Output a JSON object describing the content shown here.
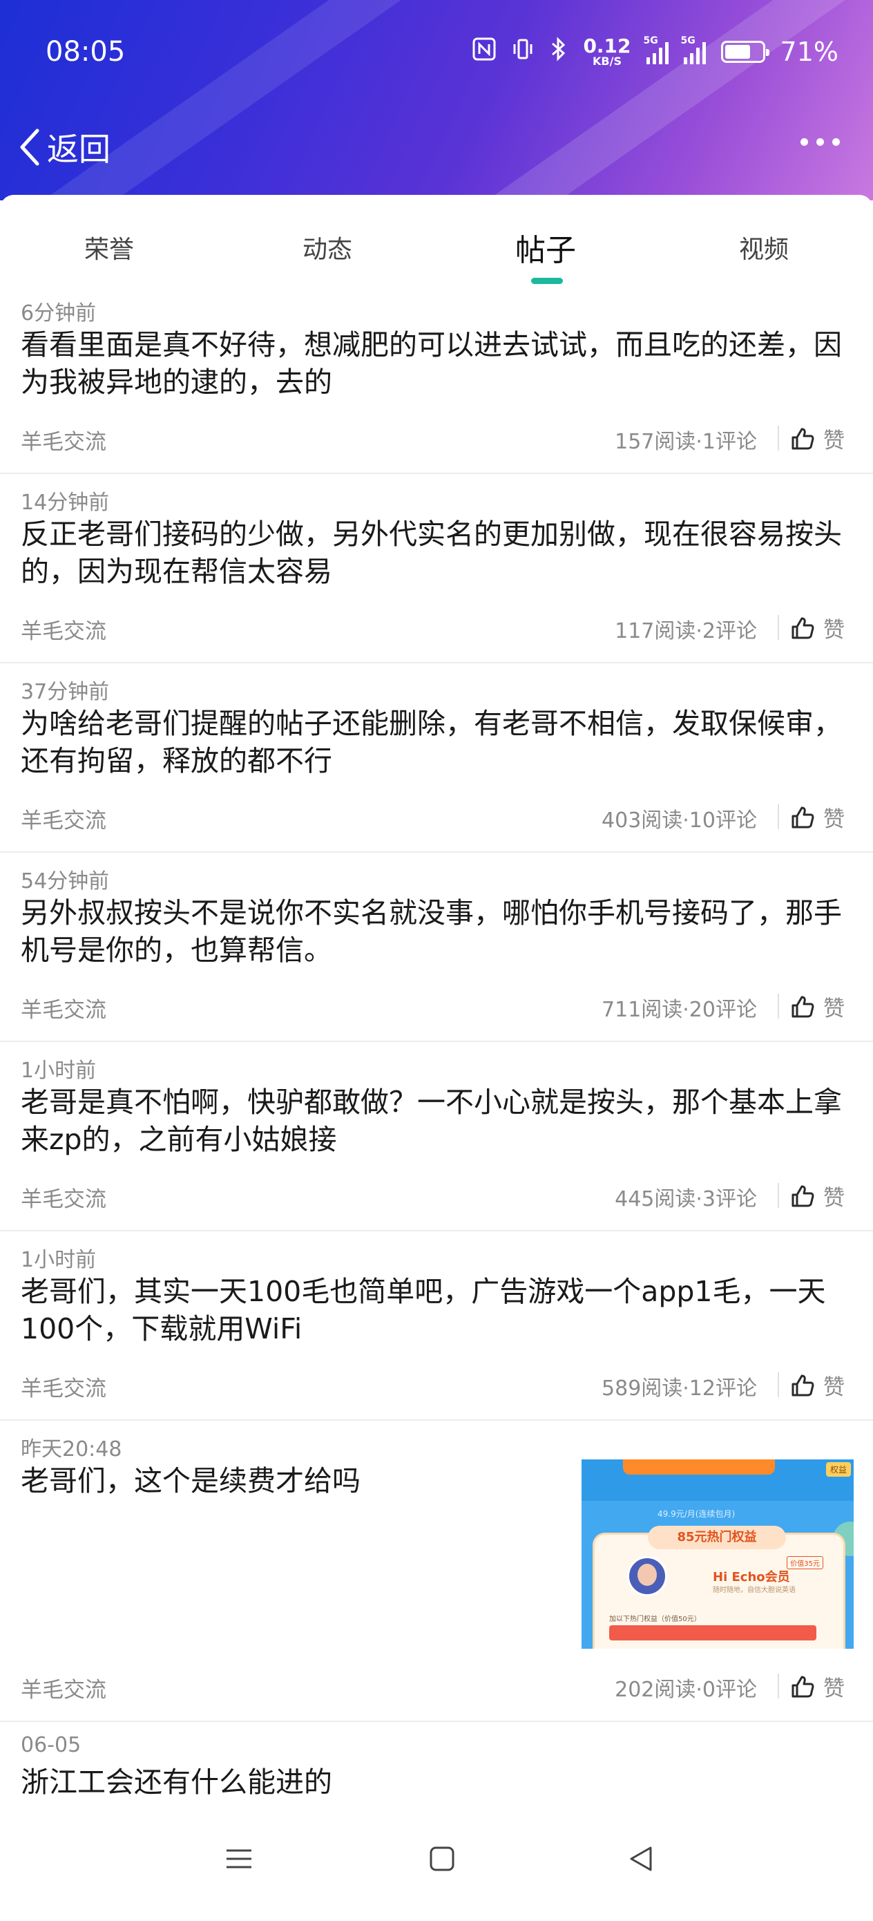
{
  "status_bar": {
    "time": "08:05",
    "net_speed_value": "0.12",
    "net_speed_unit": "KB/S",
    "sim1_tag": "5G",
    "sim2_tag": "5G",
    "battery_level": 0.71,
    "battery_text": "71%"
  },
  "nav": {
    "back_label": "返回"
  },
  "tabs": [
    {
      "label": "荣誉",
      "active": false
    },
    {
      "label": "动态",
      "active": false
    },
    {
      "label": "帖子",
      "active": true
    },
    {
      "label": "视频",
      "active": false
    }
  ],
  "posts": [
    {
      "time": "6分钟前",
      "title": "看看里面是真不好待，想减肥的可以进去试试，而且吃的还差，因为我被异地的逮的，去的",
      "category": "羊毛交流",
      "stats": "157阅读·1评论",
      "like_label": "赞"
    },
    {
      "time": "14分钟前",
      "title": "反正老哥们接码的少做，另外代实名的更加别做，现在很容易按头的，因为现在帮信太容易",
      "category": "羊毛交流",
      "stats": "117阅读·2评论",
      "like_label": "赞"
    },
    {
      "time": "37分钟前",
      "title": "为啥给老哥们提醒的帖子还能删除，有老哥不相信，发取保候审，还有拘留，释放的都不行",
      "category": "羊毛交流",
      "stats": "403阅读·10评论",
      "like_label": "赞"
    },
    {
      "time": "54分钟前",
      "title": "另外叔叔按头不是说你不实名就没事，哪怕你手机号接码了，那手机号是你的，也算帮信。",
      "category": "羊毛交流",
      "stats": "711阅读·20评论",
      "like_label": "赞"
    },
    {
      "time": "1小时前",
      "title": "老哥是真不怕啊，快驴都敢做？一不小心就是按头，那个基本上拿来zp的，之前有小姑娘接",
      "category": "羊毛交流",
      "stats": "445阅读·3评论",
      "like_label": "赞"
    },
    {
      "time": "1小时前",
      "title": "老哥们，其实一天100毛也简单吧，广告游戏一个app1毛，一天100个，下载就用WiFi",
      "category": "羊毛交流",
      "stats": "589阅读·12评论",
      "like_label": "赞"
    },
    {
      "time": "昨天20:48",
      "title": "老哥们，这个是续费才给吗",
      "category": "羊毛交流",
      "stats": "202阅读·0评论",
      "like_label": "赞",
      "thumbnail": {
        "price_text": "49.9元/月(连续包月)",
        "pill_text": "85元热门权益",
        "card_title": "Hi Echo会员",
        "card_sub": "随时随地，自信大胆说英语",
        "card_tag": "价值35元",
        "line_text": "加以下热门权益（价值50元）",
        "badge_text": "权益"
      }
    },
    {
      "time": "06-05",
      "title": "浙江工会还有什么能进的"
    }
  ],
  "colors": {
    "accent": "#1cb89c",
    "header_gradient_start": "#1d2fd6",
    "header_gradient_end": "#c879e0",
    "muted_text": "#8a8a8a"
  },
  "icons": {
    "back": "chevron-left-icon",
    "more": "more-dots-icon",
    "like": "thumbs-up-icon",
    "nfc": "nfc-icon",
    "vibrate": "vibrate-icon",
    "bluetooth": "bluetooth-icon",
    "menu": "menu-icon",
    "home": "home-icon",
    "back_nav": "back-triangle-icon"
  }
}
